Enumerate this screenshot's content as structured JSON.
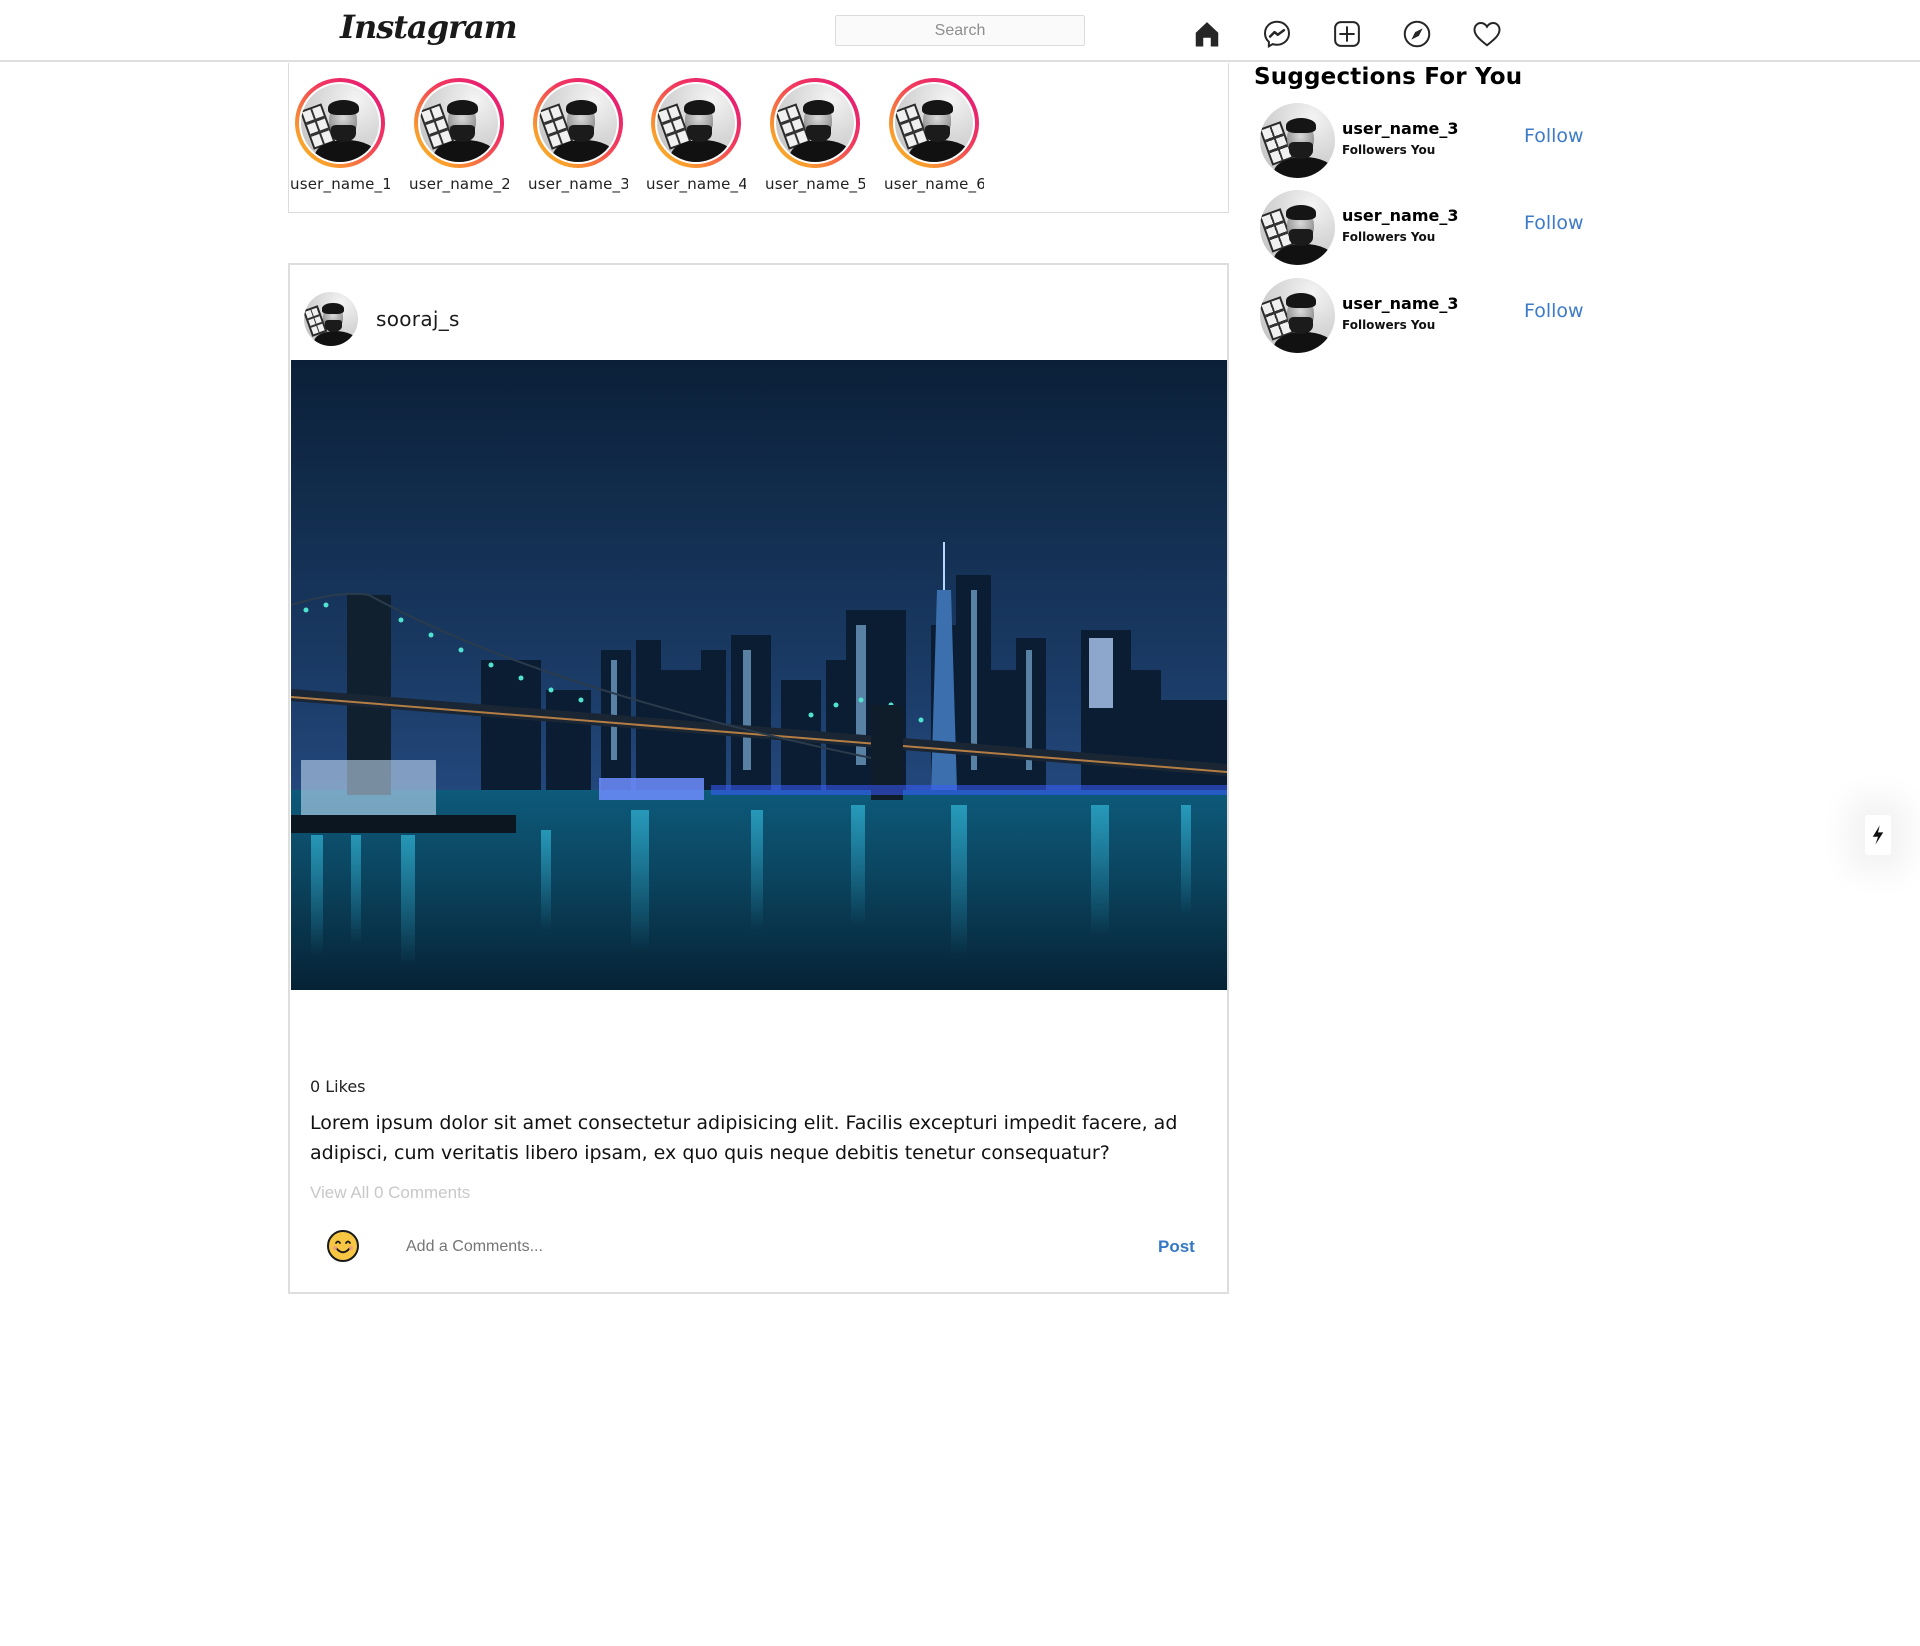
{
  "header": {
    "logo": "Instagram",
    "search_placeholder": "Search",
    "nav_icons": [
      "home-icon",
      "messenger-icon",
      "new-post-icon",
      "explore-icon",
      "activity-heart-icon"
    ]
  },
  "stories": [
    {
      "label": "user_name_1"
    },
    {
      "label": "user_name_2"
    },
    {
      "label": "user_name_3"
    },
    {
      "label": "user_name_4"
    },
    {
      "label": "user_name_5"
    },
    {
      "label": "user_name_6"
    }
  ],
  "post": {
    "username": "sooraj_s",
    "image_alt": "Brooklyn Bridge and Manhattan skyline at night",
    "likes": "0 Likes",
    "caption": "Lorem ipsum dolor sit amet consectetur adipisicing elit. Facilis excepturi impedit facere, ad adipisci, cum veritatis libero ipsam, ex quo quis neque debitis tenetur consequatur?",
    "view_comments": "View All 0 Comments",
    "comment_placeholder": "Add a Comments...",
    "post_button": "Post"
  },
  "suggestions": {
    "title": "Suggections For You",
    "items": [
      {
        "username": "user_name_3",
        "subtitle": "Followers You",
        "action": "Follow"
      },
      {
        "username": "user_name_3",
        "subtitle": "Followers You",
        "action": "Follow"
      },
      {
        "username": "user_name_3",
        "subtitle": "Followers You",
        "action": "Follow"
      }
    ]
  },
  "colors": {
    "accent_blue": "#3d7bc8",
    "post_blue": "#3478c6",
    "story_gradient_start": "#e1117d",
    "story_gradient_end": "#fbb42a",
    "border": "#dedede"
  }
}
